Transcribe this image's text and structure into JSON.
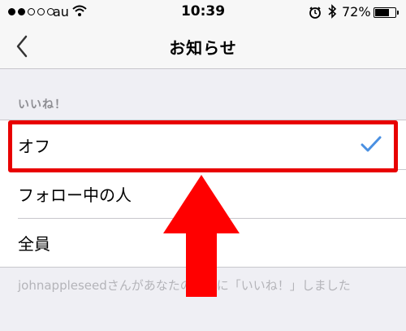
{
  "status_bar": {
    "carrier": "au",
    "time": "10:39",
    "battery": "72%",
    "signal_bars_filled": 2,
    "signal_bars_total": 5,
    "battery_level": 0.72,
    "icons": [
      "wifi-icon",
      "alarm-icon",
      "bluetooth-icon",
      "battery-icon"
    ]
  },
  "nav": {
    "title": "お知らせ",
    "back_icon": "chevron-left-icon"
  },
  "section": {
    "header": "いいね！",
    "options": [
      {
        "label": "オフ",
        "selected": true
      },
      {
        "label": "フォロー中の人",
        "selected": false
      },
      {
        "label": "全員",
        "selected": false
      }
    ],
    "footer": "johnappleseedさんがあなたの写真に「いいね！」しました"
  },
  "annotation": {
    "highlight_color": "#e80000",
    "arrow_color": "#ff0000"
  },
  "colors": {
    "accent": "#4a90e2",
    "background": "#efeff4",
    "secondary_text": "#8e8e93"
  }
}
